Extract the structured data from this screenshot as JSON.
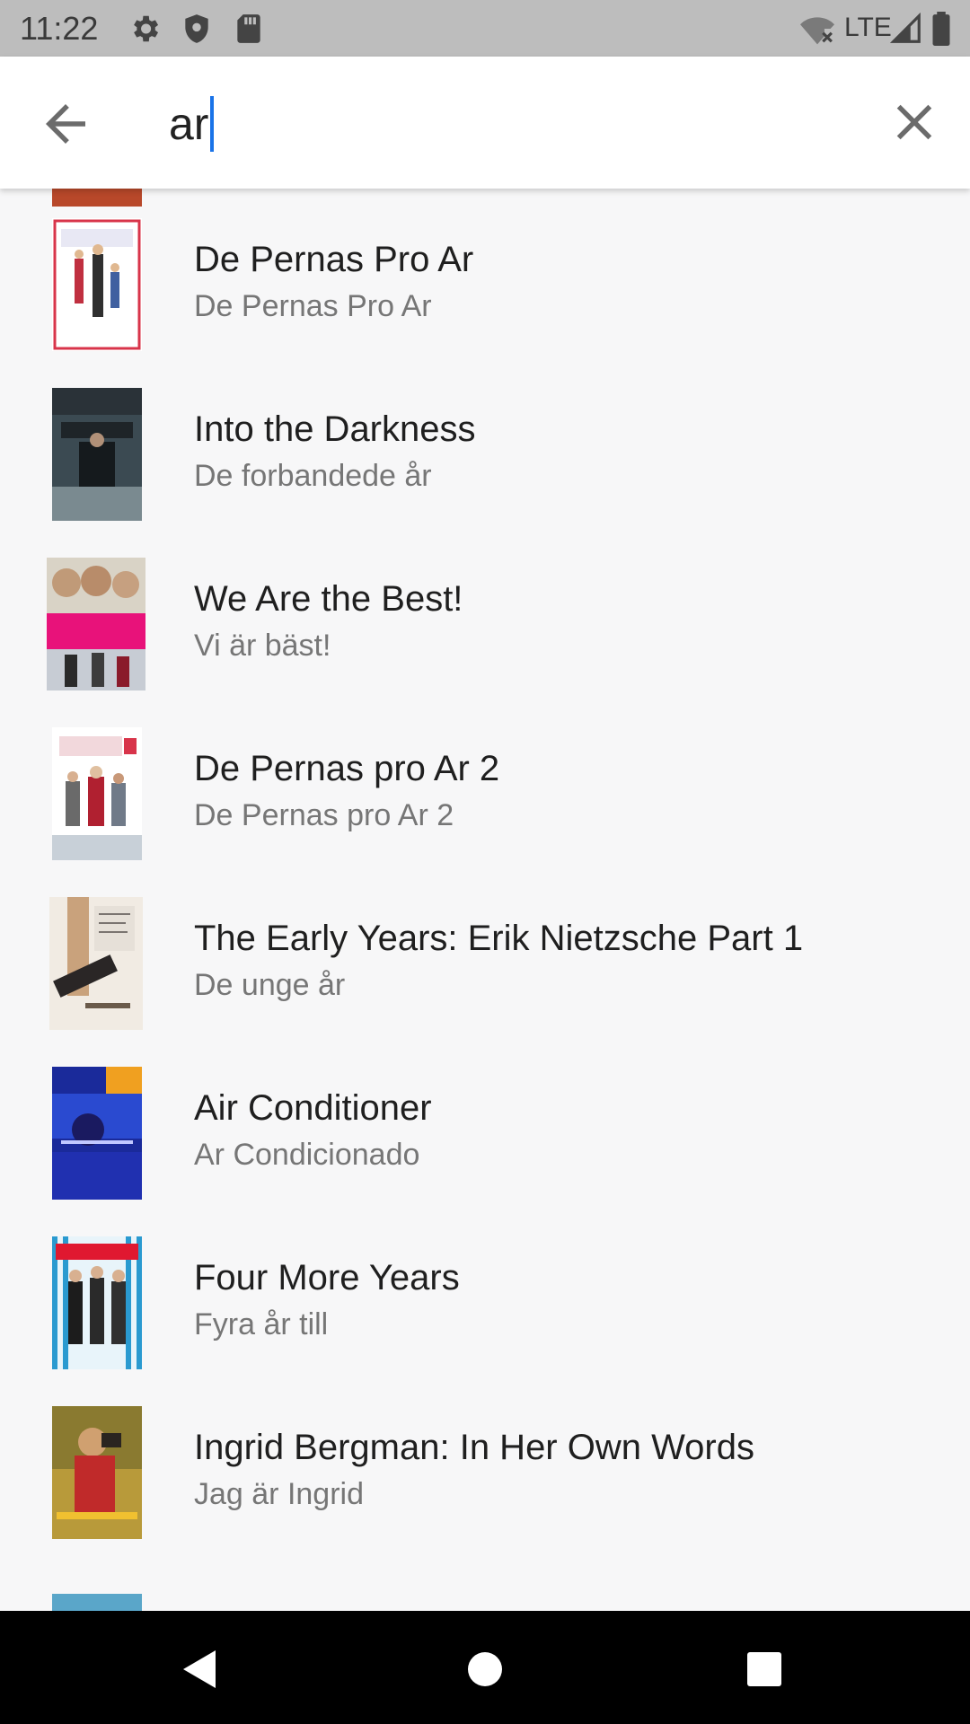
{
  "status_bar": {
    "time": "11:22",
    "network": "LTE",
    "icons": [
      "settings-icon",
      "shield-icon",
      "sd-card-icon",
      "wifi-off-icon",
      "signal-icon",
      "battery-icon"
    ]
  },
  "search": {
    "query": "ar",
    "icons": [
      "arrow-back-icon",
      "close-icon"
    ],
    "caret_color": "#1a73e8"
  },
  "results": [
    {
      "title": "De Pernas Pro Ar",
      "subtitle": "De Pernas Pro Ar",
      "poster_icon": "poster-image"
    },
    {
      "title": "Into the Darkness",
      "subtitle": "De forbandede år",
      "poster_icon": "poster-image"
    },
    {
      "title": "We Are the Best!",
      "subtitle": "Vi är bäst!",
      "poster_icon": "poster-image"
    },
    {
      "title": "De Pernas pro Ar 2",
      "subtitle": "De Pernas pro Ar 2",
      "poster_icon": "poster-image"
    },
    {
      "title": "The Early Years: Erik Nietzsche Part 1",
      "subtitle": "De unge år",
      "poster_icon": "poster-image"
    },
    {
      "title": "Air Conditioner",
      "subtitle": "Ar Condicionado",
      "poster_icon": "poster-image"
    },
    {
      "title": "Four More Years",
      "subtitle": "Fyra år till",
      "poster_icon": "poster-image"
    },
    {
      "title": "Ingrid Bergman: In Her Own Words",
      "subtitle": "Jag är Ingrid",
      "poster_icon": "poster-image"
    }
  ],
  "nav_bar": {
    "icons": [
      "nav-back-icon",
      "nav-home-icon",
      "nav-recents-icon"
    ]
  }
}
